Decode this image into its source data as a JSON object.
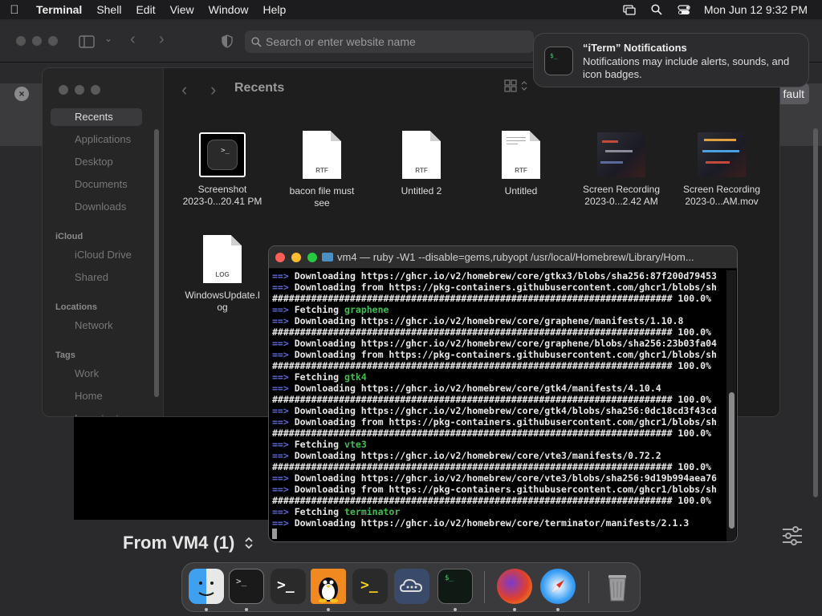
{
  "menubar": {
    "app": "Terminal",
    "items": [
      "Shell",
      "Edit",
      "View",
      "Window",
      "Help"
    ],
    "clock": "Mon Jun 12  9:32 PM"
  },
  "browser": {
    "address_placeholder": "Search or enter website name",
    "default_button": "fault",
    "from_vm_label": "From VM4 (1)"
  },
  "finder": {
    "title": "Recents",
    "sidebar": {
      "favorites": [
        "Recents",
        "Applications",
        "Desktop",
        "Documents",
        "Downloads"
      ],
      "icloud_header": "iCloud",
      "icloud": [
        "iCloud Drive",
        "Shared"
      ],
      "locations_header": "Locations",
      "locations": [
        "Network"
      ],
      "tags_header": "Tags",
      "tags": [
        "Work",
        "Home",
        "Important"
      ]
    },
    "files": [
      {
        "name": "Screenshot\n2023-0...20.41 PM",
        "kind": "screenshot"
      },
      {
        "name": "bacon file must\nsee",
        "kind": "rtf",
        "ext": "RTF"
      },
      {
        "name": "Untitled 2",
        "kind": "rtf",
        "ext": "RTF"
      },
      {
        "name": "Untitled",
        "kind": "rtf",
        "ext": "RTF"
      },
      {
        "name": "Screen Recording\n2023-0...2.42 AM",
        "kind": "recording"
      },
      {
        "name": "Screen Recording\n2023-0...AM.mov",
        "kind": "recording"
      },
      {
        "name": "WindowsUpdate.l\nog",
        "kind": "log",
        "ext": "LOG"
      }
    ]
  },
  "notification": {
    "title": "“iTerm” Notifications",
    "body": "Notifications may include alerts, sounds, and icon badges."
  },
  "terminal": {
    "title": "vm4 — ruby -W1 --disable=gems,rubyopt /usr/local/Homebrew/Library/Hom...",
    "lines": [
      {
        "t": "dl",
        "text": "Downloading https://ghcr.io/v2/homebrew/core/gtkx3/blobs/sha256:87f200d79453"
      },
      {
        "t": "dl",
        "text": "Downloading from https://pkg-containers.githubusercontent.com/ghcr1/blobs/sh"
      },
      {
        "t": "bar",
        "text": "######################################################################## 100.0%"
      },
      {
        "t": "fetch",
        "text": "graphene"
      },
      {
        "t": "dl",
        "text": "Downloading https://ghcr.io/v2/homebrew/core/graphene/manifests/1.10.8"
      },
      {
        "t": "bar",
        "text": "######################################################################## 100.0%"
      },
      {
        "t": "dl",
        "text": "Downloading https://ghcr.io/v2/homebrew/core/graphene/blobs/sha256:23b03fa04"
      },
      {
        "t": "dl",
        "text": "Downloading from https://pkg-containers.githubusercontent.com/ghcr1/blobs/sh"
      },
      {
        "t": "bar",
        "text": "######################################################################## 100.0%"
      },
      {
        "t": "fetch",
        "text": "gtk4"
      },
      {
        "t": "dl",
        "text": "Downloading https://ghcr.io/v2/homebrew/core/gtk4/manifests/4.10.4"
      },
      {
        "t": "bar",
        "text": "######################################################################## 100.0%"
      },
      {
        "t": "dl",
        "text": "Downloading https://ghcr.io/v2/homebrew/core/gtk4/blobs/sha256:0dc18cd3f43cd"
      },
      {
        "t": "dl",
        "text": "Downloading from https://pkg-containers.githubusercontent.com/ghcr1/blobs/sh"
      },
      {
        "t": "bar",
        "text": "######################################################################## 100.0%"
      },
      {
        "t": "fetch",
        "text": "vte3"
      },
      {
        "t": "dl",
        "text": "Downloading https://ghcr.io/v2/homebrew/core/vte3/manifests/0.72.2"
      },
      {
        "t": "bar",
        "text": "######################################################################## 100.0%"
      },
      {
        "t": "dl",
        "text": "Downloading https://ghcr.io/v2/homebrew/core/vte3/blobs/sha256:9d19b994aea76"
      },
      {
        "t": "dl",
        "text": "Downloading from https://pkg-containers.githubusercontent.com/ghcr1/blobs/sh"
      },
      {
        "t": "bar",
        "text": "######################################################################## 100.0%"
      },
      {
        "t": "fetch",
        "text": "terminator"
      },
      {
        "t": "dl",
        "text": "Downloading https://ghcr.io/v2/homebrew/core/terminator/manifests/2.1.3"
      }
    ],
    "arrow": "==>",
    "fetch_prefix": "Fetching"
  },
  "dock": {
    "apps": [
      "finder-icon",
      "terminal-icon",
      "powershell-icon",
      "linux-vm-icon",
      "console-icon",
      "cloud-icon",
      "iterm-icon",
      "firefox-icon",
      "safari-icon",
      "trash-icon"
    ]
  },
  "colors": {
    "accent_arrow": "#5b6be0",
    "fetch_green": "#3fbf4f",
    "close_red": "#ff5f57",
    "min_yellow": "#febc2e",
    "max_green": "#28c840"
  }
}
